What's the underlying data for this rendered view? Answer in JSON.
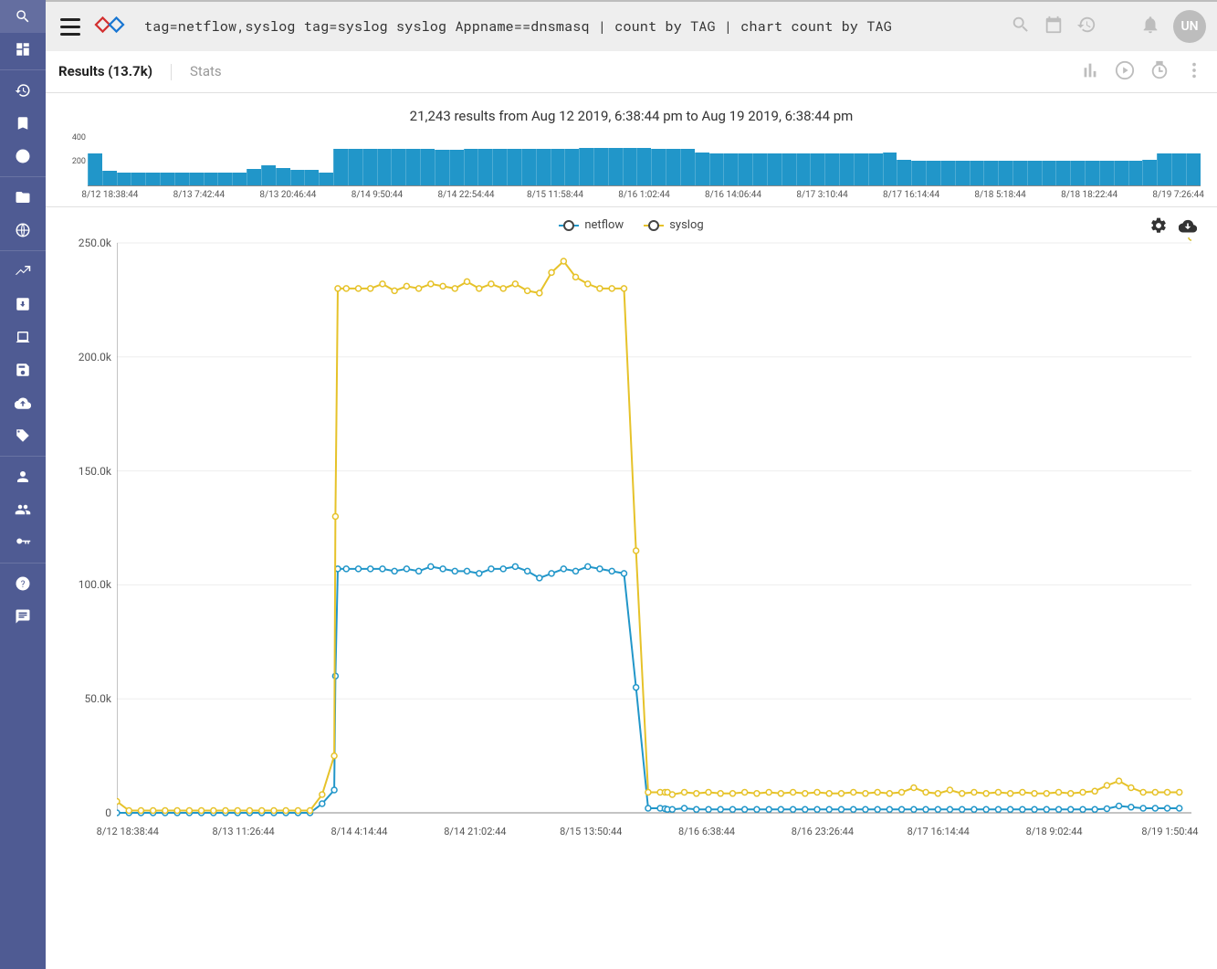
{
  "topbar": {
    "query": "tag=netflow,syslog tag=syslog syslog Appname==dnsmasq | count by TAG | chart count by TAG",
    "avatar_initials": "UN"
  },
  "tabs": {
    "results_label": "Results (13.7k)",
    "stats_label": "Stats"
  },
  "overview": {
    "summary": "21,243 results from Aug 12 2019, 6:38:44 pm to Aug 19 2019, 6:38:44 pm"
  },
  "chart_data": [
    {
      "type": "bar",
      "title": "",
      "ylim": [
        0,
        420
      ],
      "y_ticks": [
        200,
        400
      ],
      "categories": [
        "8/12 18:38:44",
        "8/13 7:42:44",
        "8/13 20:46:44",
        "8/14 9:50:44",
        "8/14 22:54:44",
        "8/15 11:58:44",
        "8/16 1:02:44",
        "8/16 14:06:44",
        "8/17 3:10:44",
        "8/17 16:14:44",
        "8/18 5:18:44",
        "8/18 18:22:44",
        "8/19 7:26:44"
      ],
      "values": [
        260,
        120,
        105,
        105,
        105,
        105,
        105,
        105,
        105,
        105,
        105,
        135,
        165,
        140,
        130,
        130,
        105,
        300,
        300,
        300,
        300,
        300,
        300,
        300,
        295,
        290,
        300,
        300,
        300,
        300,
        300,
        300,
        300,
        300,
        305,
        305,
        310,
        310,
        305,
        300,
        300,
        300,
        270,
        265,
        265,
        265,
        265,
        265,
        265,
        265,
        265,
        265,
        265,
        265,
        265,
        270,
        210,
        200,
        200,
        200,
        200,
        200,
        200,
        200,
        200,
        200,
        200,
        200,
        200,
        200,
        200,
        200,
        205,
        210,
        260,
        265,
        265
      ]
    },
    {
      "type": "line",
      "legend": [
        "netflow",
        "syslog"
      ],
      "colors": [
        "#2196c9",
        "#e6c229"
      ],
      "ylabel": "",
      "ylim": [
        0,
        250000
      ],
      "y_ticks_display": [
        "0",
        "50.0k",
        "100.0k",
        "150.0k",
        "200.0k",
        "250.0k"
      ],
      "x_categories": [
        "8/12 18:38:44",
        "8/13 11:26:44",
        "8/14 4:14:44",
        "8/14 21:02:44",
        "8/15 13:50:44",
        "8/16 6:38:44",
        "8/16 23:26:44",
        "8/17 16:14:44",
        "8/18 9:02:44",
        "8/19 1:50:44"
      ],
      "x": [
        0,
        1,
        2,
        3,
        4,
        5,
        6,
        7,
        8,
        9,
        10,
        11,
        12,
        13,
        14,
        15,
        16,
        17,
        18,
        18.1,
        18.3,
        19,
        20,
        21,
        22,
        23,
        24,
        25,
        26,
        27,
        28,
        29,
        30,
        31,
        32,
        33,
        34,
        35,
        36,
        37,
        38,
        39,
        40,
        41,
        42,
        43,
        44,
        45,
        45.4,
        45.6,
        46,
        47,
        48,
        49,
        50,
        51,
        52,
        53,
        54,
        55,
        56,
        57,
        58,
        59,
        60,
        61,
        62,
        63,
        64,
        65,
        66,
        67,
        68,
        69,
        70,
        71,
        72,
        73,
        74,
        75,
        76,
        77,
        78,
        79,
        80,
        81,
        82,
        83,
        84,
        85,
        86,
        87,
        88,
        89
      ],
      "series": [
        {
          "name": "netflow",
          "values": [
            0,
            0,
            0,
            0,
            0,
            0,
            0,
            0,
            0,
            0,
            0,
            0,
            0,
            0,
            0,
            0,
            0,
            4000,
            10000,
            60000,
            107000,
            107000,
            107000,
            107000,
            107000,
            106000,
            107000,
            106000,
            108000,
            107000,
            106000,
            106000,
            105000,
            107000,
            107000,
            108000,
            106000,
            103000,
            105000,
            107000,
            106000,
            108000,
            107000,
            106000,
            105000,
            55000,
            2000,
            2000,
            1800,
            1500,
            1500,
            2000,
            1500,
            1500,
            1500,
            1500,
            1500,
            1500,
            1500,
            1500,
            1500,
            1500,
            1500,
            1500,
            1500,
            1500,
            1500,
            1500,
            1500,
            1500,
            1500,
            1500,
            1500,
            1500,
            1500,
            1500,
            1500,
            1500,
            1500,
            1500,
            1500,
            1500,
            1500,
            1500,
            1500,
            1500,
            1800,
            3000,
            2500,
            2000,
            2000,
            2000,
            2000
          ]
        },
        {
          "name": "syslog",
          "values": [
            5000,
            1000,
            1000,
            1000,
            1000,
            1000,
            1000,
            1000,
            1000,
            1000,
            1000,
            1000,
            1000,
            1000,
            1000,
            1000,
            1000,
            8000,
            25000,
            130000,
            230000,
            230000,
            230000,
            230000,
            232000,
            229000,
            231000,
            230000,
            232000,
            231000,
            230000,
            233000,
            230000,
            232000,
            230000,
            232000,
            229000,
            228000,
            237000,
            242000,
            235000,
            232000,
            230000,
            230000,
            230000,
            115000,
            9000,
            9000,
            9000,
            9000,
            8000,
            9000,
            8500,
            9000,
            8500,
            8500,
            9000,
            8500,
            9000,
            8500,
            9000,
            8500,
            9000,
            8500,
            8500,
            9000,
            8500,
            9000,
            8500,
            9000,
            11000,
            9000,
            8500,
            10000,
            8500,
            9000,
            8500,
            9000,
            8500,
            9000,
            8500,
            8500,
            9000,
            8500,
            9000,
            9500,
            12000,
            14000,
            11000,
            9000,
            9000,
            9000,
            9000
          ]
        }
      ]
    }
  ]
}
